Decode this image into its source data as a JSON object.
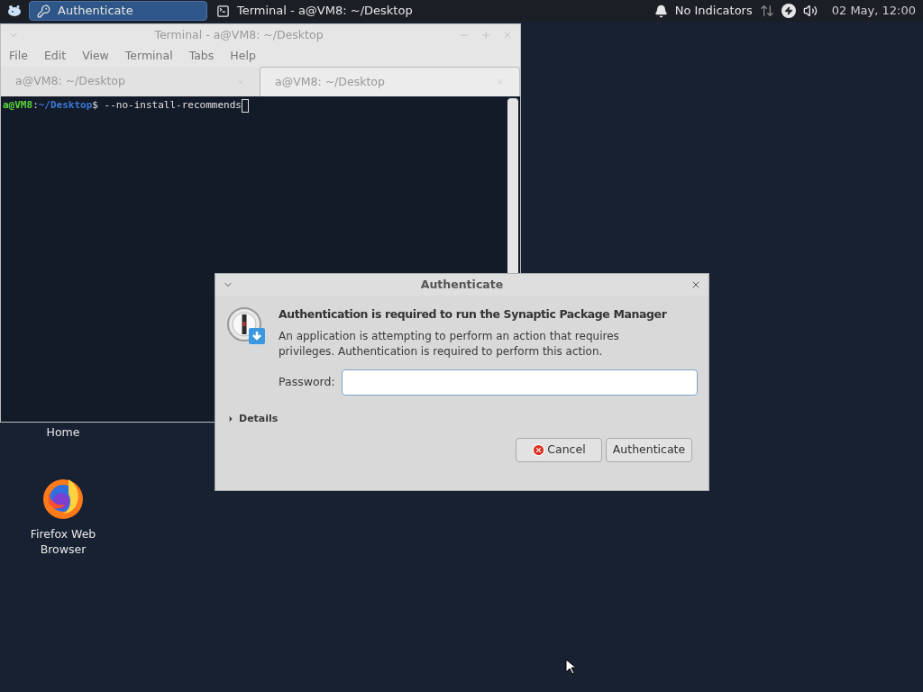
{
  "taskbar": {
    "tasks": [
      {
        "label": "Authenticate",
        "kind": "auth",
        "selected": true
      },
      {
        "label": "Terminal - a@VM8: ~/Desktop",
        "kind": "terminal",
        "selected": false
      }
    ],
    "indicators_label": "No Indicators",
    "clock": "02 May, 12:00"
  },
  "terminal": {
    "title": "Terminal - a@VM8: ~/Desktop",
    "active": false,
    "menu": [
      "File",
      "Edit",
      "View",
      "Terminal",
      "Tabs",
      "Help"
    ],
    "tabs": [
      {
        "label": "a@VM8: ~/Desktop",
        "selected": false
      },
      {
        "label": "a@VM8: ~/Desktop",
        "selected": true
      }
    ],
    "prompt": {
      "user": "a@VM8",
      "separator": ":",
      "path": "~/Desktop",
      "symbol": "$",
      "command": " --no-install-recommends"
    }
  },
  "desktop": {
    "home_label": "Home",
    "firefox_label": "Firefox Web Browser"
  },
  "dialog": {
    "title": "Authenticate",
    "heading": "Authentication is required to run the Synaptic Package Manager",
    "message": "An application is attempting to perform an action that requires privileges. Authentication is required to perform this action.",
    "password_label": "Password:",
    "details": {
      "label": "Details",
      "expanded": false
    },
    "buttons": [
      {
        "label": "Cancel",
        "kind": "cancel"
      },
      {
        "label": "Authenticate",
        "kind": "default"
      }
    ]
  }
}
